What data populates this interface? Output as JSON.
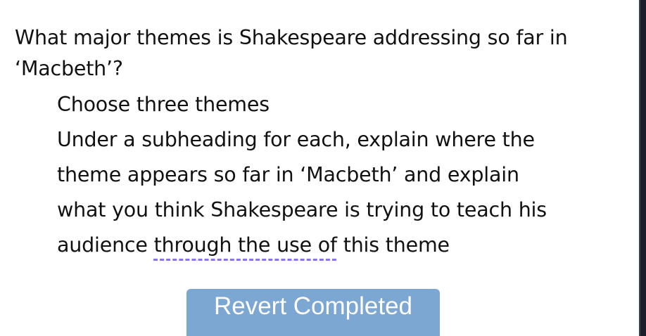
{
  "question": {
    "line1": "What major themes is Shakespeare addressing so far in",
    "line2": "‘Macbeth’?"
  },
  "instructions": {
    "item1": "Choose three themes",
    "item2_lines": [
      "Under a subheading for each, explain where the",
      "theme appears so far in ‘Macbeth’ and explain",
      "what you think Shakespeare is trying to teach his"
    ],
    "item2_last_prefix": "audience ",
    "item2_last_marked": "through the use of",
    "item2_last_suffix": " this theme"
  },
  "revert_button": {
    "label": "Revert Completed",
    "color": "#7ca7d3"
  },
  "spellcheck_color": "#8a74ee"
}
